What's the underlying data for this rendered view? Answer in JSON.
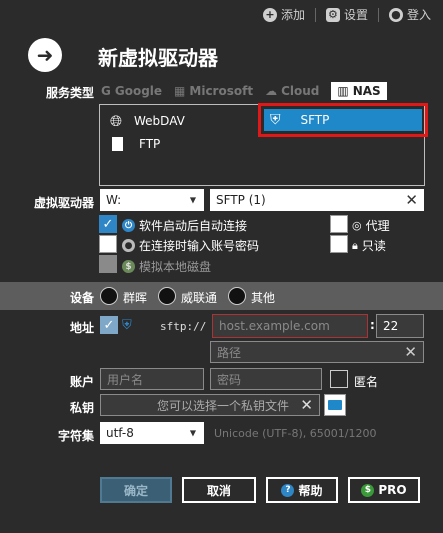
{
  "topbar": {
    "add": "添加",
    "settings": "设置",
    "login": "登入"
  },
  "title": "新虚拟驱动器",
  "labels": {
    "service_type": "服务类型",
    "virtual_drive": "虚拟驱动器",
    "device": "设备",
    "address": "地址",
    "account": "账户",
    "private_key": "私钥",
    "charset": "字符集"
  },
  "service_tabs": [
    "Google",
    "Microsoft",
    "Cloud",
    "NAS"
  ],
  "services": [
    "WebDAV",
    "FTP",
    "SFTP"
  ],
  "drive": {
    "letter": "W:",
    "name": "SFTP (1)"
  },
  "options": {
    "auto_connect": "软件启动后自动连接",
    "ask_password": "在连接时输入账号密码",
    "simulate_disk": "模拟本地磁盘",
    "proxy": "代理",
    "readonly": "只读"
  },
  "devices": [
    "群晖",
    "威联通",
    "其他"
  ],
  "address": {
    "prefix": "sftp://",
    "host_placeholder": "host.example.com",
    "port": "22",
    "path_placeholder": "路径"
  },
  "account": {
    "user_placeholder": "用户名",
    "pass_placeholder": "密码",
    "anonymous": "匿名"
  },
  "key": {
    "placeholder": "您可以选择一个私钥文件"
  },
  "charset": {
    "value": "utf-8",
    "hint": "Unicode (UTF-8), 65001/1200"
  },
  "buttons": {
    "ok": "确定",
    "cancel": "取消",
    "help": "帮助",
    "pro": "PRO"
  }
}
